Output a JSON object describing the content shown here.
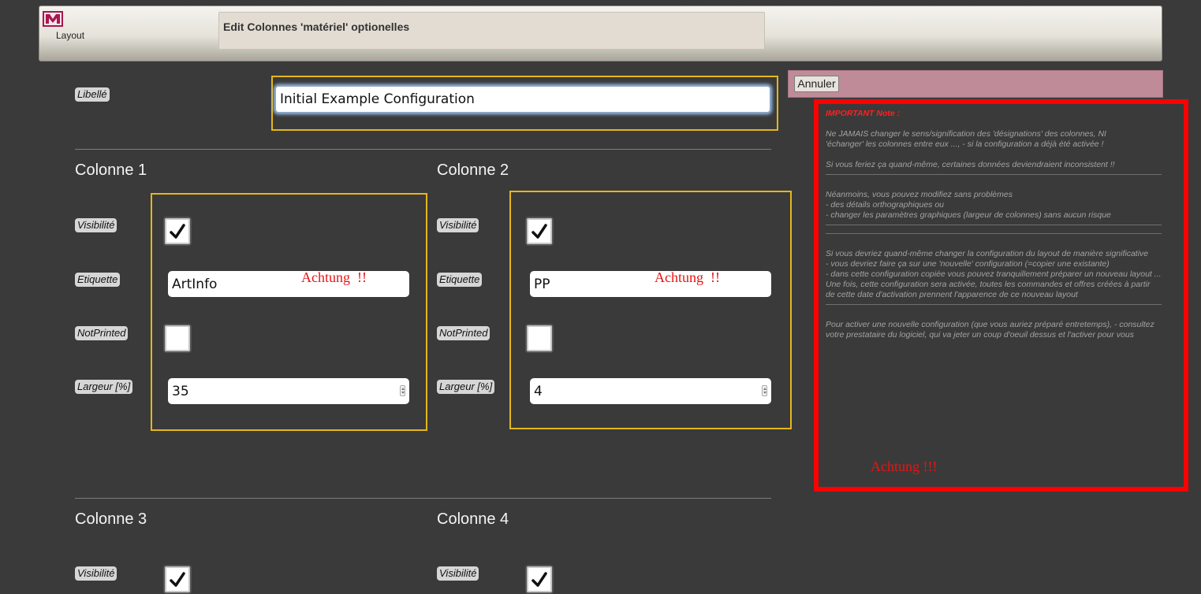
{
  "header": {
    "layout_link": "Layout",
    "page_title": "Edit Colonnes 'matériel' optionelles",
    "logo_icon": "app-logo-icon"
  },
  "actions": {
    "cancel_label": "Annuler"
  },
  "form": {
    "libelle_label": "Libellé",
    "libelle_value": "Initial Example Configuration",
    "field_labels": {
      "visibility": "Visibilité",
      "label": "Etiquette",
      "not_printed": "NotPrinted",
      "width": "Largeur [%]"
    },
    "columns": [
      {
        "title": "Colonne 1",
        "visible": true,
        "etiquette": "ArtInfo",
        "not_printed": false,
        "largeur": "35"
      },
      {
        "title": "Colonne 2",
        "visible": true,
        "etiquette": "PP",
        "not_printed": false,
        "largeur": "4"
      },
      {
        "title": "Colonne 3",
        "visible": true
      },
      {
        "title": "Colonne 4",
        "visible": true
      }
    ]
  },
  "annotations": {
    "achtung_small": "Achtung  !!",
    "achtung_big": "Achtung !!!",
    "color": "#e81414"
  },
  "note": {
    "heading": "IMPORTANT Note",
    "heading_suffix": " :",
    "p1_line1": "Ne JAMAIS changer le sens/signification des 'désignations' des colonnes, NI",
    "p1_line2": "'échanger' les colonnes entre eux ..., - si la configuration a déjà été activée !",
    "p2": "Si vous feriez ça quand-même, certaines données deviendraient inconsistent !!",
    "p3_line1": "Néanmoins, vous pouvez modifiez sans problèmes",
    "p3_line2": "- des détails orthographiques ou",
    "p3_line3": "- changer les paramètres graphiques (largeur de colonnes) sans aucun risque",
    "p4_line1": "Si vous devriez quand-même changer la configuration du layout de manière significative",
    "p4_line2": "- vous devriez faire ça sur une 'nouvelle' configuration (=copier une existante)",
    "p4_line3": "- dans cette configuration copiée vous pouvez tranquillement préparer un nouveau layout ...",
    "p4_line4": "Une fois, cette configuration sera activée, toutes les commandes et offres créées à partir de cette date d'activation prennent l'apparence de ce nouveau layout",
    "p5": "Pour activer une nouvelle configuration (que vous auriez préparé entretemps), - consultez votre prestataire du logiciel, qui va jeter un coup d'oeuil dessus et l'activer pour vous"
  }
}
